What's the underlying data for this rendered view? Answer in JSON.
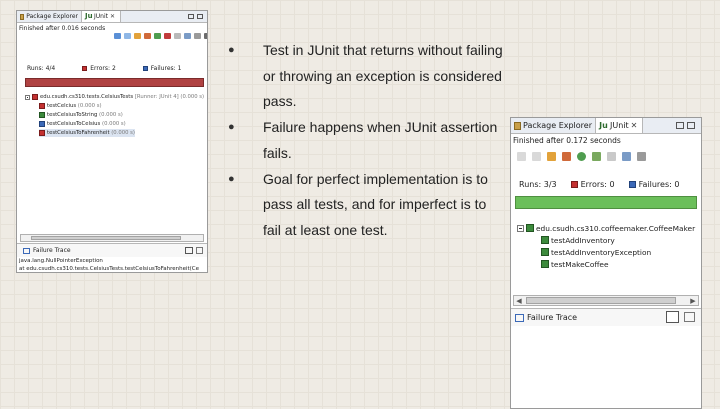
{
  "left_panel": {
    "tabs": [
      {
        "label": "Package Explorer",
        "icon": "package-icon"
      },
      {
        "label": "JUnit",
        "icon": "junit-icon"
      }
    ],
    "status": "Finished after 0.016 seconds",
    "counters": {
      "runs_label": "Runs:",
      "runs_value": "4/4",
      "errors_label": "Errors:",
      "errors_value": "2",
      "failures_label": "Failures:",
      "failures_value": "1"
    },
    "bar_color": "#b04242",
    "tree": [
      {
        "label": "edu.csudh.cs310.tests.CelsiusTests",
        "detail": "[Runner: JUnit 4] (0.000 s)",
        "indent": 0
      },
      {
        "label": "testCelcius",
        "detail": "(0.000 s)",
        "indent": 1
      },
      {
        "label": "testCelsiusToString",
        "detail": "(0.000 s)",
        "indent": 1
      },
      {
        "label": "testCelsiusToCelsius",
        "detail": "(0.000 s)",
        "indent": 1
      },
      {
        "label": "testCelsiusToFahrenheit",
        "detail": "(0.000 s)",
        "indent": 1
      }
    ],
    "trace_title": "Failure Trace",
    "trace_lines": [
      "java.lang.NullPointerException",
      "at edu.csudh.cs310.tests.CelsiusTests.testCelsiusToFahrenheit(Ce"
    ]
  },
  "bullets": [
    "Test in JUnit that returns without failing or throwing an exception is considered pass.",
    "Failure happens when JUnit assertion fails.",
    "Goal for perfect implementation is to pass all tests, and for imperfect is to fail at least one test."
  ],
  "bullet_glyph": "●",
  "right_panel": {
    "tabs": [
      {
        "label": "Package Explorer",
        "icon": "package-icon"
      },
      {
        "label": "JUnit",
        "icon": "junit-icon"
      }
    ],
    "status": "Finished after 0.172 seconds",
    "counters": {
      "runs_label": "Runs:",
      "runs_value": "3/3",
      "errors_label": "Errors:",
      "errors_value": "0",
      "failures_label": "Failures:",
      "failures_value": "0"
    },
    "bar_color": "#6bbf5a",
    "tree": [
      {
        "label": "edu.csudh.cs310.coffeemaker.CoffeeMaker",
        "indent": 0
      },
      {
        "label": "testAddInventory",
        "indent": 1
      },
      {
        "label": "testAddInventoryException",
        "indent": 1
      },
      {
        "label": "testMakeCoffee",
        "indent": 1
      }
    ],
    "trace_title": "Failure Trace"
  }
}
